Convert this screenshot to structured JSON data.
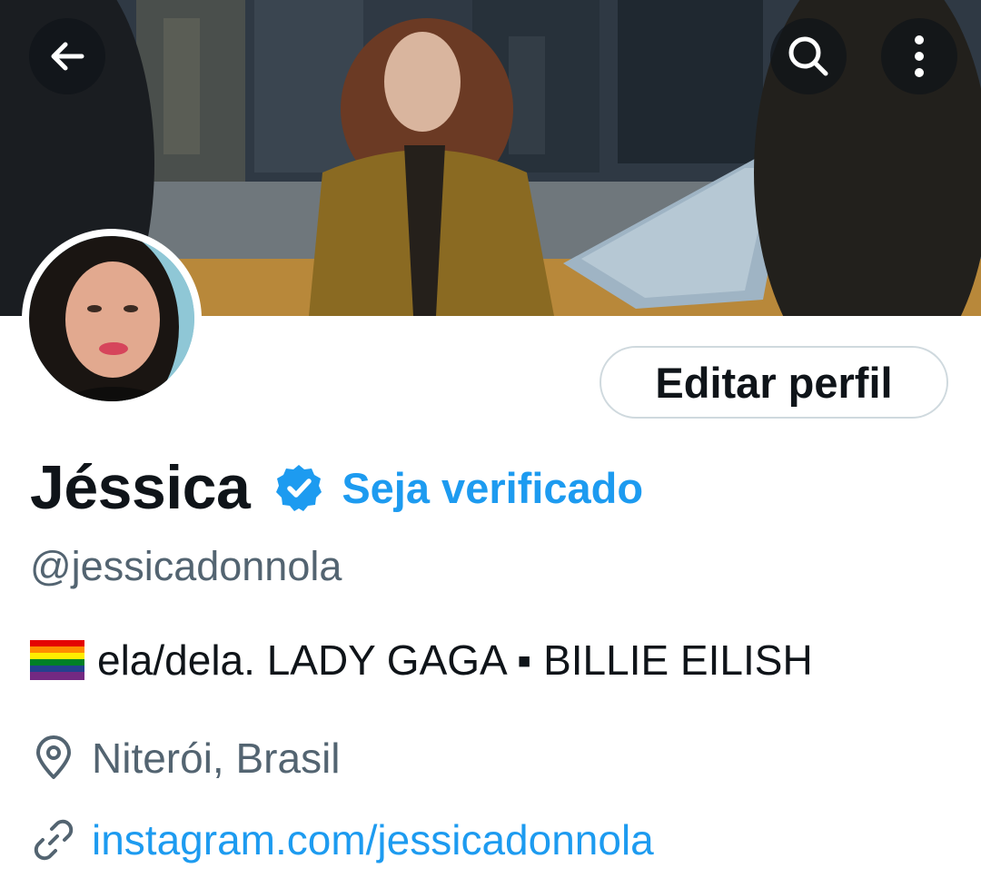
{
  "header": {
    "back_icon": "arrow-left-icon",
    "search_icon": "search-icon",
    "more_icon": "more-vertical-icon"
  },
  "profile": {
    "name": "Jéssica",
    "verified_icon": "verified-badge-icon",
    "get_verified_label": "Seja verificado",
    "handle": "@jessicadonnola",
    "edit_profile_label": "Editar perfil",
    "bio": {
      "flag_icon": "rainbow-flag-icon",
      "text": "ela/dela. LADY GAGA ▪ BILLIE EILISH"
    },
    "location": {
      "icon": "location-pin-icon",
      "text": "Niterói, Brasil"
    },
    "website": {
      "icon": "link-icon",
      "text": "instagram.com/jessicadonnola"
    }
  },
  "colors": {
    "accent": "#1d9bf0",
    "text_primary": "#0f1419",
    "text_secondary": "#536471",
    "border": "#cfd9de"
  }
}
